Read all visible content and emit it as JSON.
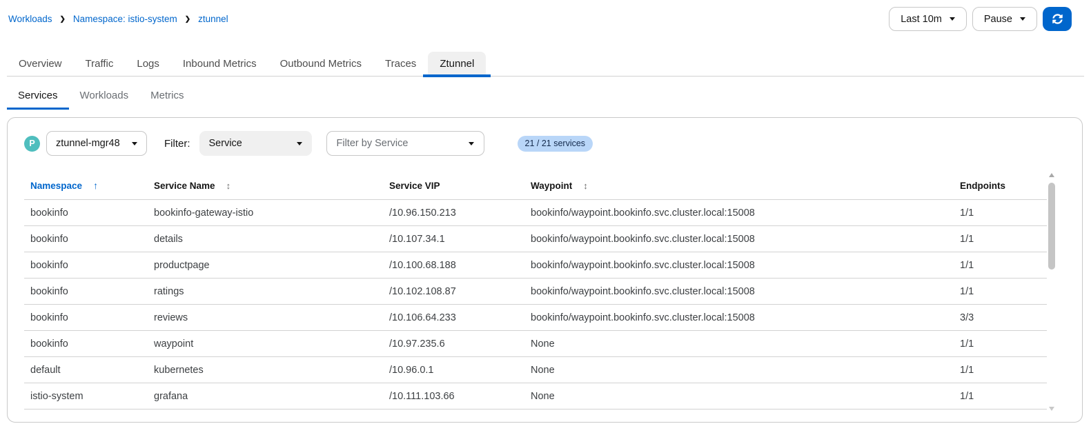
{
  "breadcrumb": {
    "items": [
      "Workloads",
      "Namespace: istio-system",
      "ztunnel"
    ]
  },
  "toolbar": {
    "time_range": "Last 10m",
    "refresh_interval": "Pause"
  },
  "tabs": {
    "items": [
      "Overview",
      "Traffic",
      "Logs",
      "Inbound Metrics",
      "Outbound Metrics",
      "Traces",
      "Ztunnel"
    ],
    "active": "Ztunnel"
  },
  "subtabs": {
    "items": [
      "Services",
      "Workloads",
      "Metrics"
    ],
    "active": "Services"
  },
  "filters": {
    "pod_badge": "P",
    "pod_selected": "ztunnel-mgr48",
    "filter_label": "Filter:",
    "filter_type_selected": "Service",
    "filter_placeholder": "Filter by Service",
    "count_badge": "21 / 21 services"
  },
  "table": {
    "columns": [
      {
        "key": "namespace",
        "label": "Namespace",
        "sort": "asc"
      },
      {
        "key": "service_name",
        "label": "Service Name",
        "sort": "sortable"
      },
      {
        "key": "service_vip",
        "label": "Service VIP",
        "sort": "none"
      },
      {
        "key": "waypoint",
        "label": "Waypoint",
        "sort": "sortable"
      },
      {
        "key": "endpoints",
        "label": "Endpoints",
        "sort": "none"
      }
    ],
    "rows": [
      {
        "namespace": "bookinfo",
        "service_name": "bookinfo-gateway-istio",
        "service_vip": "/10.96.150.213",
        "waypoint": "bookinfo/waypoint.bookinfo.svc.cluster.local:15008",
        "endpoints": "1/1"
      },
      {
        "namespace": "bookinfo",
        "service_name": "details",
        "service_vip": "/10.107.34.1",
        "waypoint": "bookinfo/waypoint.bookinfo.svc.cluster.local:15008",
        "endpoints": "1/1"
      },
      {
        "namespace": "bookinfo",
        "service_name": "productpage",
        "service_vip": "/10.100.68.188",
        "waypoint": "bookinfo/waypoint.bookinfo.svc.cluster.local:15008",
        "endpoints": "1/1"
      },
      {
        "namespace": "bookinfo",
        "service_name": "ratings",
        "service_vip": "/10.102.108.87",
        "waypoint": "bookinfo/waypoint.bookinfo.svc.cluster.local:15008",
        "endpoints": "1/1"
      },
      {
        "namespace": "bookinfo",
        "service_name": "reviews",
        "service_vip": "/10.106.64.233",
        "waypoint": "bookinfo/waypoint.bookinfo.svc.cluster.local:15008",
        "endpoints": "3/3"
      },
      {
        "namespace": "bookinfo",
        "service_name": "waypoint",
        "service_vip": "/10.97.235.6",
        "waypoint": "None",
        "endpoints": "1/1"
      },
      {
        "namespace": "default",
        "service_name": "kubernetes",
        "service_vip": "/10.96.0.1",
        "waypoint": "None",
        "endpoints": "1/1"
      },
      {
        "namespace": "istio-system",
        "service_name": "grafana",
        "service_vip": "/10.111.103.66",
        "waypoint": "None",
        "endpoints": "1/1"
      }
    ]
  },
  "colors": {
    "accent": "#0066cc",
    "pod_badge_bg": "#4fbebe",
    "count_badge_bg": "#b9d6f8",
    "count_badge_text": "#13294b"
  }
}
